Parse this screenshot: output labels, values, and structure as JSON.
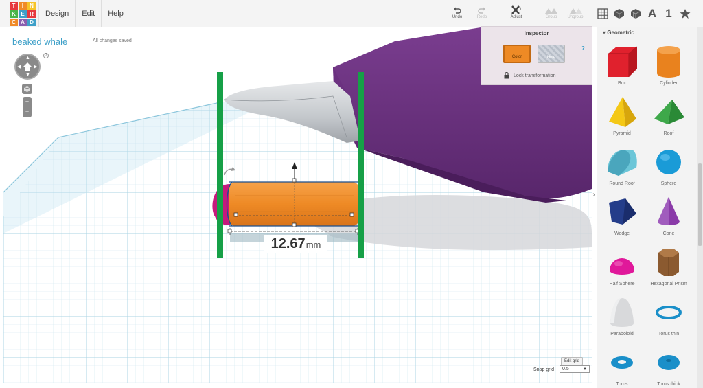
{
  "app": {
    "logo_letters": [
      "T",
      "I",
      "N",
      "K",
      "E",
      "R",
      "C",
      "A",
      "D"
    ],
    "logo_colors": [
      "#e6383d",
      "#f08a28",
      "#f6c429",
      "#49b549",
      "#3ea0c8",
      "#e6383d",
      "#f08a28",
      "#8a5fb0",
      "#3ea0c8"
    ]
  },
  "menu": [
    {
      "label": "Design"
    },
    {
      "label": "Edit"
    },
    {
      "label": "Help"
    }
  ],
  "toolbar": {
    "undo": "Undo",
    "redo": "Redo",
    "adjust": "Adjust",
    "group": "Group",
    "ungroup": "Ungroup"
  },
  "view_controls": {
    "text_label": "A",
    "number_label": "1"
  },
  "design": {
    "title": "beaked whale",
    "save_status": "All changes saved",
    "help": "?"
  },
  "dimension": {
    "value": "12.67",
    "unit": "mm"
  },
  "inspector": {
    "title": "Inspector",
    "color_label": "Color",
    "hole_label": "Hole",
    "lock_label": "Lock transformation",
    "help": "?",
    "selected_color": "#ee8a25"
  },
  "grid": {
    "edit_label": "Edit grid",
    "snap_label": "Snap grid",
    "snap_value": "0.5"
  },
  "sidebar": {
    "heading": "Geometric",
    "shapes": [
      {
        "label": "Box",
        "icon": "box-icon"
      },
      {
        "label": "Cylinder",
        "icon": "cylinder-icon"
      },
      {
        "label": "Pyramid",
        "icon": "pyramid-icon"
      },
      {
        "label": "Roof",
        "icon": "roof-icon"
      },
      {
        "label": "Round Roof",
        "icon": "round-roof-icon"
      },
      {
        "label": "Sphere",
        "icon": "sphere-icon"
      },
      {
        "label": "Wedge",
        "icon": "wedge-icon"
      },
      {
        "label": "Cone",
        "icon": "cone-icon"
      },
      {
        "label": "Half Sphere",
        "icon": "half-sphere-icon"
      },
      {
        "label": "Hexagonal Prism",
        "icon": "hexagonal-prism-icon"
      },
      {
        "label": "Paraboloid",
        "icon": "paraboloid-icon"
      },
      {
        "label": "Torus thin",
        "icon": "torus-thin-icon"
      },
      {
        "label": "Torus",
        "icon": "torus-icon"
      },
      {
        "label": "Torus thick",
        "icon": "torus-thick-icon"
      }
    ]
  }
}
